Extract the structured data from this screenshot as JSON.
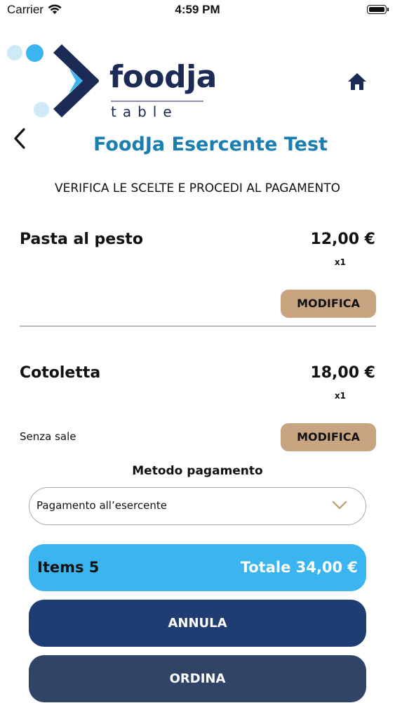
{
  "status_bar": {
    "carrier": "Carrier",
    "time": "4:59 PM"
  },
  "logo": {
    "word": "foodja",
    "sub": "table"
  },
  "header": {
    "title": "FoodJa Esercente Test",
    "subtitle": "VERIFICA LE SCELTE E PROCEDI AL PAGAMENTO"
  },
  "items": [
    {
      "name": "Pasta al pesto",
      "price": "12,00 €",
      "qty": "x1",
      "note": "",
      "modify_label": "MODIFICA"
    },
    {
      "name": "Cotoletta",
      "price": "18,00 €",
      "qty": "x1",
      "note": "Senza sale",
      "modify_label": "MODIFICA"
    }
  ],
  "payment": {
    "label": "Metodo pagamento",
    "selected": "Pagamento all’esercente"
  },
  "summary": {
    "items_label": "Items 5",
    "total_label": "Totale 34,00 €"
  },
  "actions": {
    "cancel_label": "ANNULA",
    "order_label": "ORDINA"
  },
  "colors": {
    "title": "#1a7fb0",
    "modify_button": "#c8a480",
    "summary_bar": "#3ab5ef",
    "cancel_button": "#1f3c73",
    "order_button": "#2f4466",
    "logo_navy": "#1b2b55",
    "logo_light": "#3ab5ef"
  },
  "icons": {
    "home": "home-icon",
    "back": "chevron-left-icon",
    "dropdown": "chevron-down-icon",
    "wifi": "wifi-icon",
    "battery": "battery-icon"
  }
}
